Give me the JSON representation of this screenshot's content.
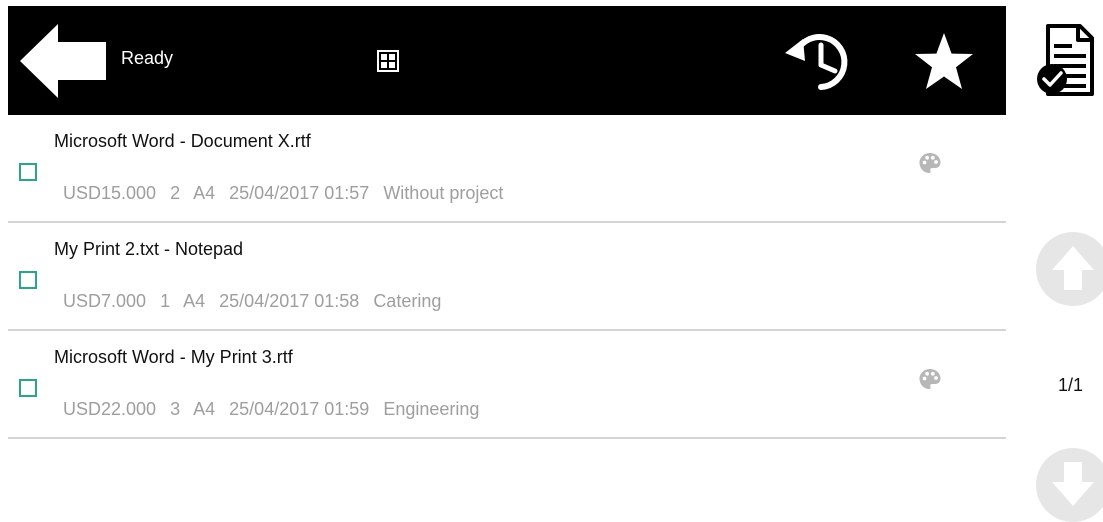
{
  "header": {
    "status": "Ready",
    "icons": {
      "back": "back-arrow-icon",
      "grid": "grid-view-icon",
      "history": "history-icon",
      "favorites": "star-icon"
    }
  },
  "jobs": [
    {
      "title": "Microsoft Word - Document X.rtf",
      "price": "USD15.000",
      "copies": "2",
      "paper": "A4",
      "datetime": "25/04/2017 01:57",
      "project": "Without project",
      "color": true,
      "selected": false
    },
    {
      "title": "My Print 2.txt - Notepad",
      "price": "USD7.000",
      "copies": "1",
      "paper": "A4",
      "datetime": "25/04/2017 01:58",
      "project": "Catering",
      "color": false,
      "selected": false
    },
    {
      "title": "Microsoft Word - My Print 3.rtf",
      "price": "USD22.000",
      "copies": "3",
      "paper": "A4",
      "datetime": "25/04/2017 01:59",
      "project": "Engineering",
      "color": true,
      "selected": false
    }
  ],
  "pagination": {
    "indicator": "1/1"
  },
  "colors": {
    "header_bg": "#000000",
    "checkbox": "#2aa58c",
    "meta_text": "#9e9e9e",
    "divider": "#d5d5d5",
    "scroll_button": "#e6e6e6"
  }
}
